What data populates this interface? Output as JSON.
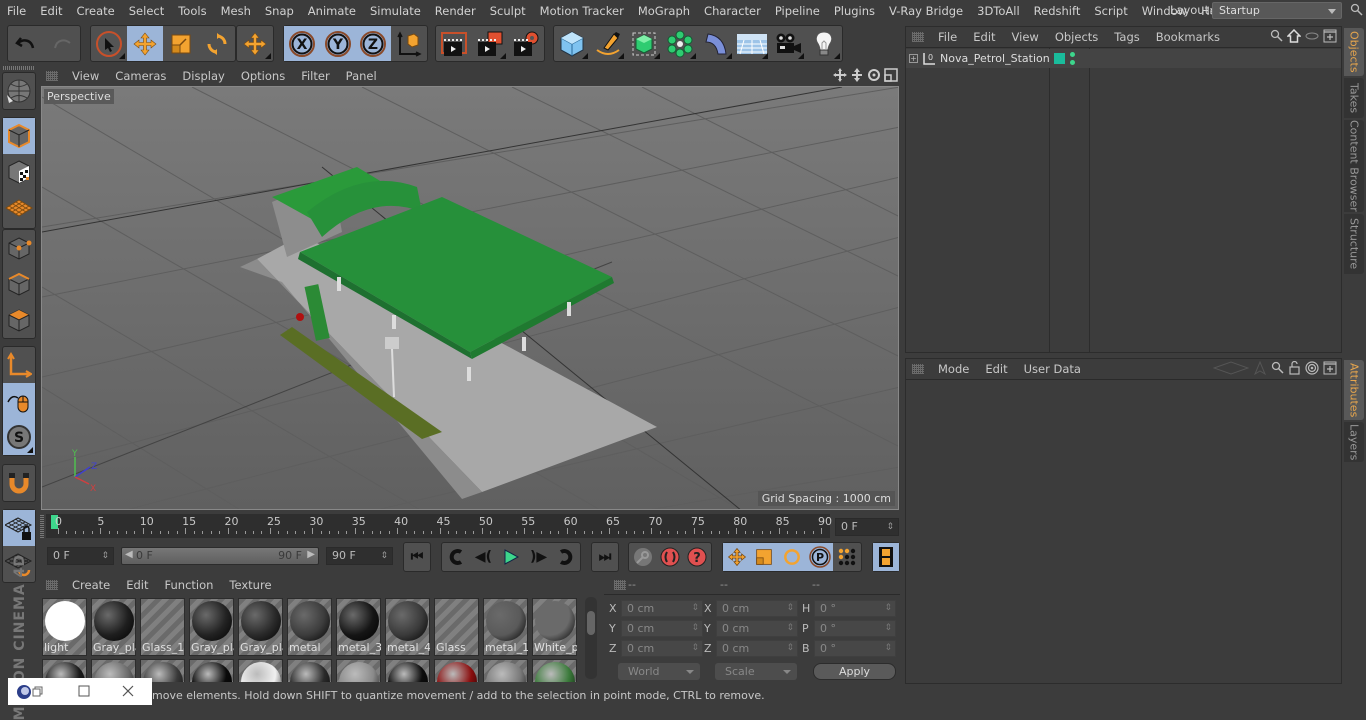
{
  "app": {
    "name": "Cinema 4D",
    "brand": "MAXON CINEMA 4D"
  },
  "menubar": {
    "items": [
      "File",
      "Edit",
      "Create",
      "Select",
      "Tools",
      "Mesh",
      "Snap",
      "Animate",
      "Simulate",
      "Render",
      "Sculpt",
      "Motion Tracker",
      "MoGraph",
      "Character",
      "Pipeline",
      "Plugins",
      "V-Ray Bridge",
      "3DToAll",
      "Redshift",
      "Script",
      "Window",
      "Help"
    ],
    "layout_label": "Layout:",
    "layout_value": "Startup"
  },
  "toolbar": {
    "groups": [
      [
        "undo-icon",
        "redo-icon"
      ],
      [
        "live-selection-icon",
        "move-icon",
        "scale-icon",
        "rotate-icon"
      ],
      [
        "coordinate-system-icon"
      ],
      [
        "x-axis-lock-icon",
        "y-axis-lock-icon",
        "z-axis-lock-icon",
        "world-coordinates-icon"
      ],
      [
        "render-view-icon",
        "render-to-picture-viewer-icon",
        "render-settings-icon"
      ],
      [
        "cube-primitive-icon",
        "pen-spline-icon",
        "subdivision-surface-icon",
        "cloner-icon",
        "bend-deformer-icon",
        "floor-icon",
        "camera-icon",
        "light-icon"
      ]
    ],
    "xyz": [
      "X",
      "Y",
      "Z"
    ]
  },
  "left_toolbar": [
    "make-editable-icon",
    "model-mode-icon",
    "texture-mode-icon",
    "workplane-mode-icon",
    "points-mode-icon",
    "edges-mode-icon",
    "polygons-mode-icon",
    "axis-mode-icon",
    "tweak-mode-icon",
    "solo-icon",
    "snap-icon",
    "workplane-lock-icon",
    "workplane-align-icon"
  ],
  "viewport": {
    "menu": [
      "View",
      "Cameras",
      "Display",
      "Options",
      "Filter",
      "Panel"
    ],
    "label": "Perspective",
    "grid_spacing": "Grid Spacing : 1000 cm",
    "axis": {
      "x": "X",
      "y": "Y",
      "z": "Z"
    }
  },
  "timeline": {
    "ticks": [
      "0",
      "5",
      "10",
      "15",
      "20",
      "25",
      "30",
      "35",
      "40",
      "45",
      "50",
      "55",
      "60",
      "65",
      "70",
      "75",
      "80",
      "85",
      "90"
    ],
    "current_frame_field": "0 F",
    "start_field": "0 F",
    "range_start": "0 F",
    "range_end": "90 F",
    "end_field": "90 F"
  },
  "materials": {
    "menu": [
      "Create",
      "Edit",
      "Function",
      "Texture"
    ],
    "row1": [
      {
        "name": "light",
        "color": "#ffffff"
      },
      {
        "name": "Gray_pla",
        "color": "#1e1e1e"
      },
      {
        "name": "Glass_1",
        "color": "none"
      },
      {
        "name": "Gray_pla",
        "color": "#222222"
      },
      {
        "name": "Gray_pla",
        "color": "#2a2a2a"
      },
      {
        "name": "metal",
        "color": "#3c3c3c"
      },
      {
        "name": "metal_3",
        "color": "#151515"
      },
      {
        "name": "metal_4",
        "color": "#3a3a3a"
      },
      {
        "name": "Glass",
        "color": "none"
      },
      {
        "name": "metal_1",
        "color": "#5a5a5a"
      },
      {
        "name": "White_p",
        "color": "#6a6a6a"
      }
    ],
    "row2_colors": [
      "#1a1a1a",
      "#6a6a6a",
      "#3a3a3a",
      "#0a0a0a",
      "#f0f0f0",
      "#2a2a2a",
      "#8a8a8a",
      "#0c0c0c",
      "#8a0e0e",
      "#7a7a7a",
      "#3a7a3a"
    ]
  },
  "coordinates": {
    "headers": [
      "--",
      "--",
      "--"
    ],
    "position": [
      {
        "axis": "X",
        "value": "0 cm"
      },
      {
        "axis": "Y",
        "value": "0 cm"
      },
      {
        "axis": "Z",
        "value": "0 cm"
      }
    ],
    "size": [
      {
        "axis": "X",
        "value": "0 cm"
      },
      {
        "axis": "Y",
        "value": "0 cm"
      },
      {
        "axis": "Z",
        "value": "0 cm"
      }
    ],
    "rotation": [
      {
        "axis": "H",
        "value": "0 °"
      },
      {
        "axis": "P",
        "value": "0 °"
      },
      {
        "axis": "B",
        "value": "0 °"
      }
    ],
    "mode_dropdown": "World",
    "type_dropdown": "Scale",
    "apply_label": "Apply"
  },
  "object_manager": {
    "menu": [
      "File",
      "Edit",
      "View",
      "Objects",
      "Tags",
      "Bookmarks"
    ],
    "objects": [
      {
        "name": "Nova_Petrol_Station",
        "tag_color": "#1abc9c"
      }
    ]
  },
  "attribute_manager": {
    "menu": [
      "Mode",
      "Edit",
      "User Data"
    ]
  },
  "side_tabs_top": [
    {
      "label": "Objects",
      "active": true
    },
    {
      "label": "Takes",
      "active": false
    },
    {
      "label": "Content Browser",
      "active": false
    },
    {
      "label": "Structure",
      "active": false
    }
  ],
  "side_tabs_bottom": [
    {
      "label": "Attributes",
      "active": true
    },
    {
      "label": "Layers",
      "active": false
    }
  ],
  "status": {
    "text": "move elements. Hold down SHIFT to quantize movement / add to the selection in point mode, CTRL to remove."
  },
  "colors": {
    "accent_orange": "#e8a64d",
    "selected_blue": "#9cb5d8",
    "play_green": "#3dd68c",
    "record_red": "#e05050"
  }
}
